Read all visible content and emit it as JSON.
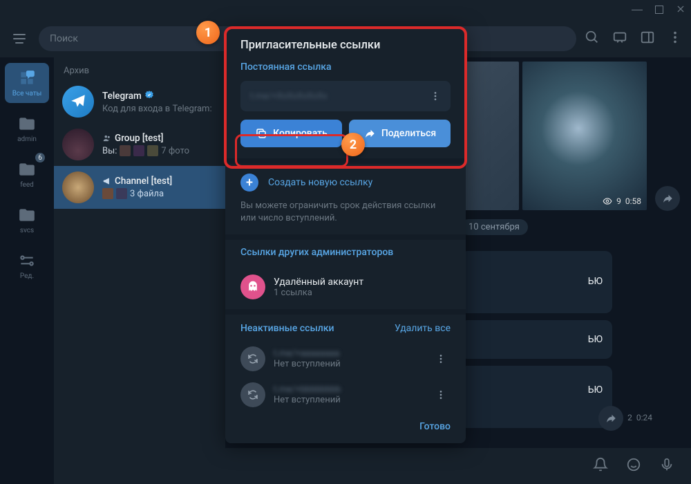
{
  "titlebar": {},
  "header": {
    "search_placeholder": "Поиск"
  },
  "nav": {
    "items": [
      {
        "label": "Все чаты"
      },
      {
        "label": "admin"
      },
      {
        "label": "feed",
        "badge": "6"
      },
      {
        "label": "svcs"
      },
      {
        "label": "Ред."
      }
    ]
  },
  "chatlist": {
    "archive_label": "Архив",
    "items": [
      {
        "name": "Telegram",
        "preview": "Код для входа в Telegram:"
      },
      {
        "name": "Group [test]",
        "you_label": "Вы:",
        "preview": "7 фото"
      },
      {
        "name": "Channel [test]",
        "preview": "3 файла"
      }
    ]
  },
  "dialog": {
    "title": "Пригласительные ссылки",
    "perm_label": "Постоянная ссылка",
    "link_value": "t.me/+XxXxXxXxXx",
    "copy_label": "Копировать",
    "share_label": "Поделиться",
    "create_label": "Создать новую ссылку",
    "hint": "Вы можете ограничить срок действия ссылки или число вступлений.",
    "others_label": "Ссылки других администраторов",
    "admin": {
      "name": "Удалённый аккаунт",
      "sub": "1 ссылка"
    },
    "inactive_label": "Неактивные ссылки",
    "delete_all": "Удалить все",
    "inactive": [
      {
        "link": "t.me/+aaaaaaaa",
        "sub": "Нет вступлений"
      },
      {
        "link": "t.me/+bbbbbbbb",
        "sub": "Нет вступлений"
      }
    ],
    "done": "Готово"
  },
  "chatarea": {
    "media_views": "9",
    "media_time": "0:58",
    "date": "сентября",
    "msg_tail": "ЬЮ",
    "meta_views": "2",
    "meta_time": "0:24"
  },
  "callouts": {
    "n1": "1",
    "n2": "2"
  }
}
